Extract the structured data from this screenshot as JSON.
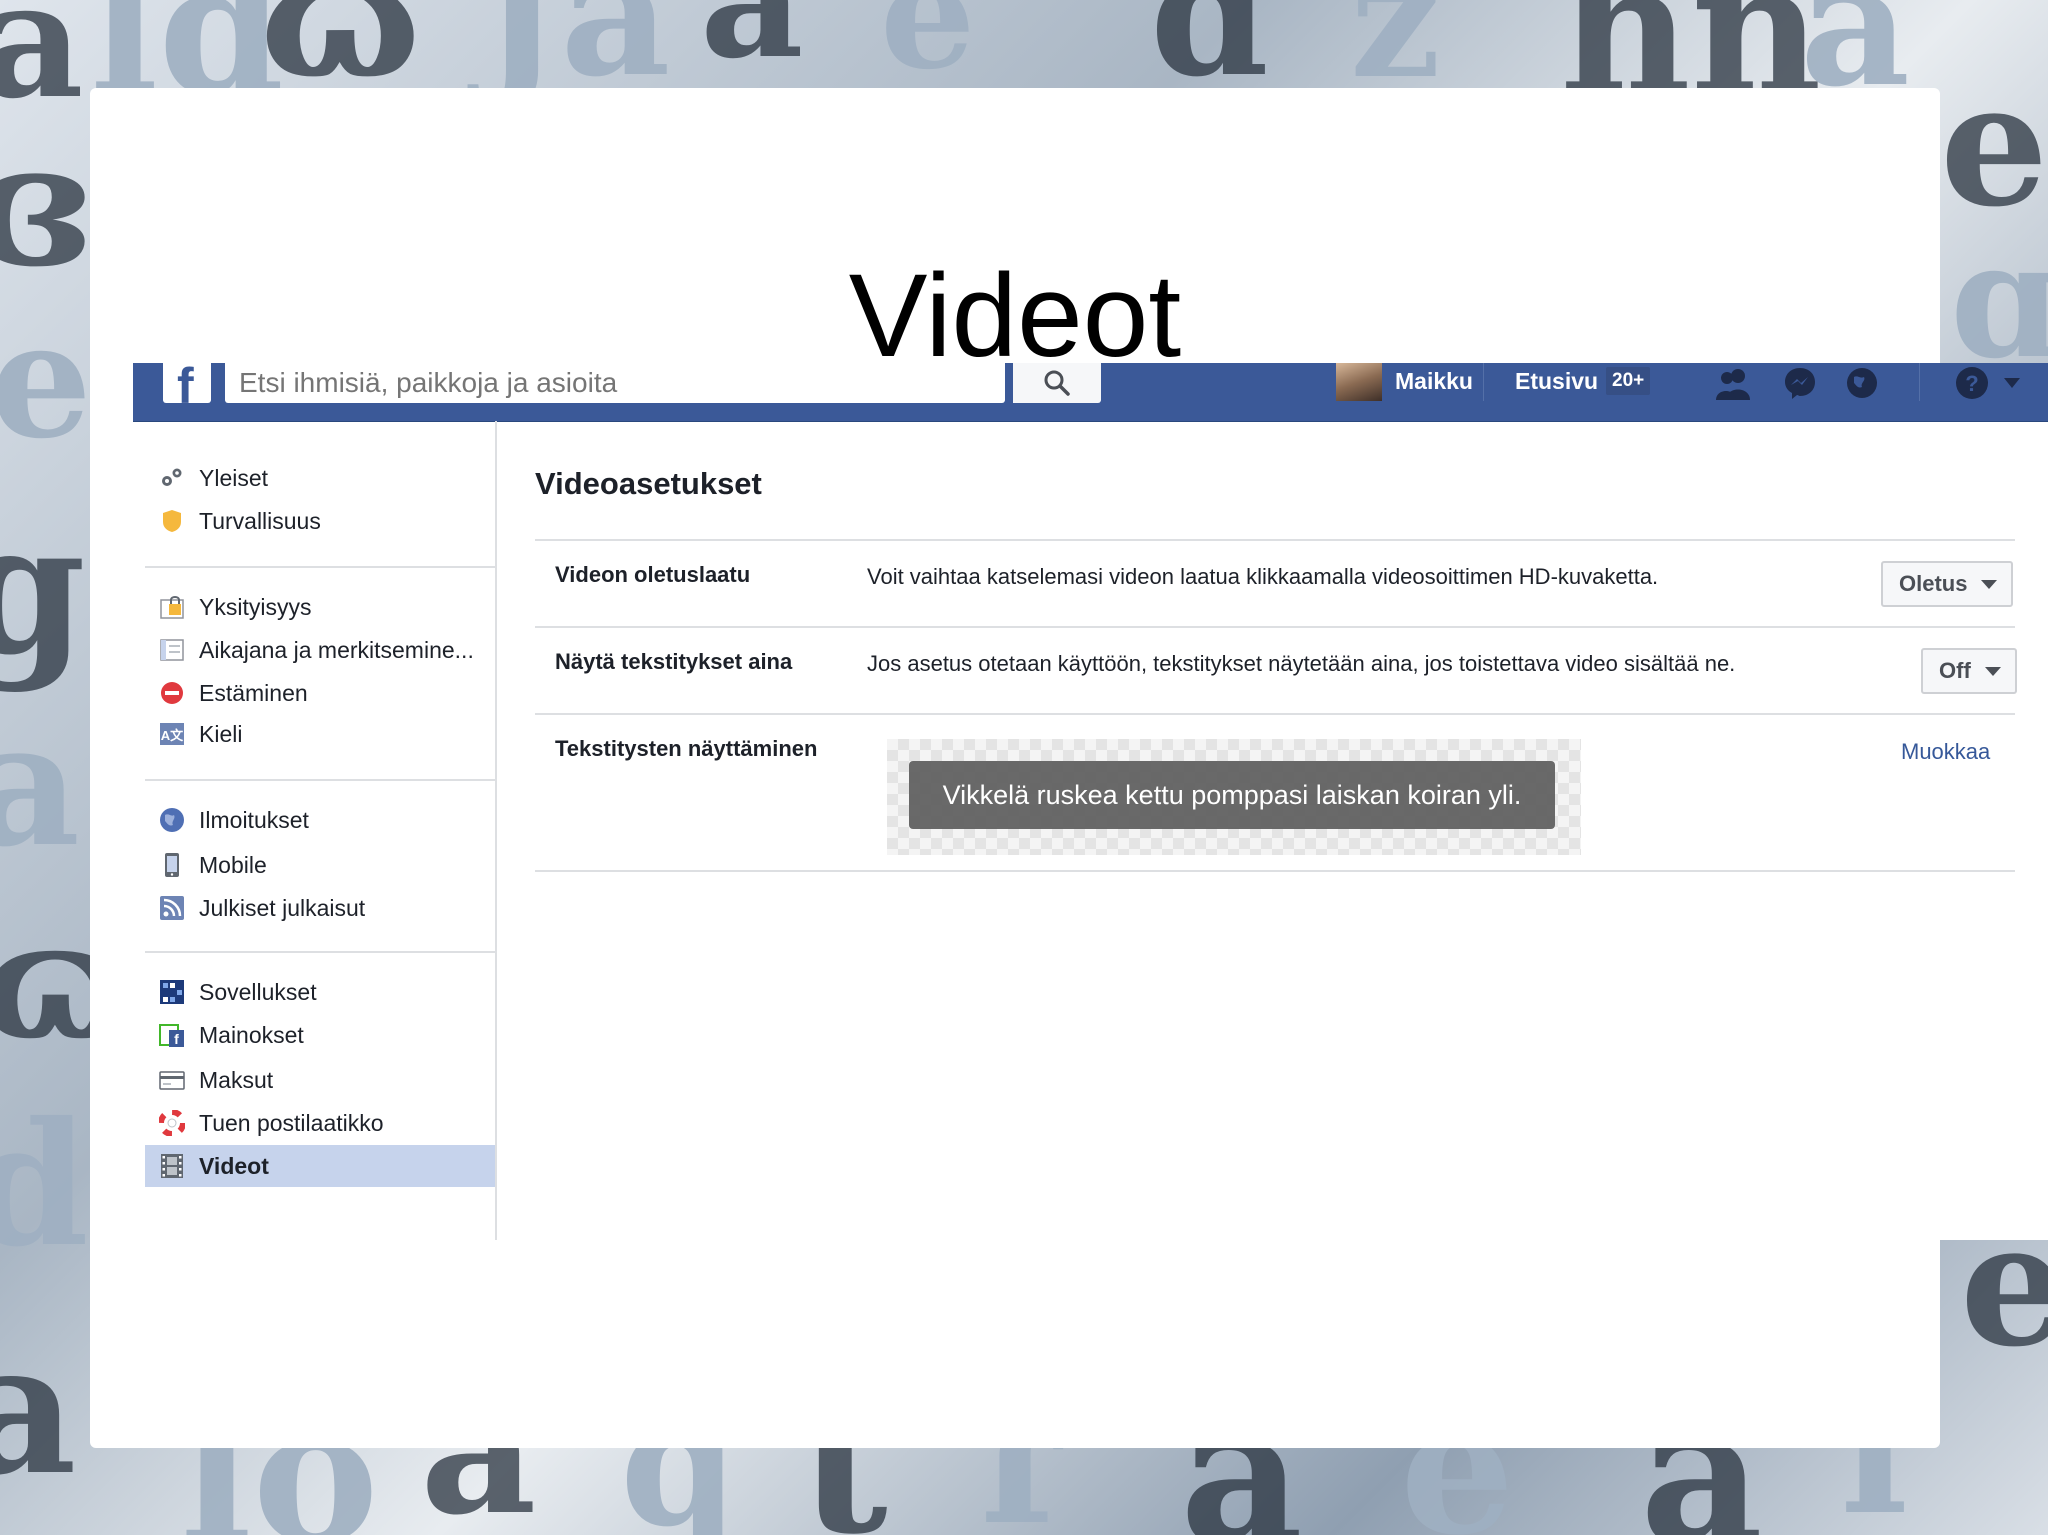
{
  "slide": {
    "title": "Videot"
  },
  "topbar": {
    "logo": "f",
    "search_placeholder": "Etsi ihmisiä, paikkoja ja asioita",
    "user_name": "Maikku",
    "home_label": "Etusivu",
    "home_badge": "20+"
  },
  "sidebar": {
    "groups": [
      [
        {
          "label": "Yleiset",
          "icon": "gears-icon"
        },
        {
          "label": "Turvallisuus",
          "icon": "badge-icon"
        }
      ],
      [
        {
          "label": "Yksityisyys",
          "icon": "lock-icon"
        },
        {
          "label": "Aikajana ja merkitsemine...",
          "icon": "timeline-icon"
        },
        {
          "label": "Estäminen",
          "icon": "block-icon"
        },
        {
          "label": "Kieli",
          "icon": "language-icon"
        }
      ],
      [
        {
          "label": "Ilmoitukset",
          "icon": "globe-icon"
        },
        {
          "label": "Mobile",
          "icon": "phone-icon"
        },
        {
          "label": "Julkiset julkaisut",
          "icon": "rss-icon"
        }
      ],
      [
        {
          "label": "Sovellukset",
          "icon": "apps-icon"
        },
        {
          "label": "Mainokset",
          "icon": "ads-icon"
        },
        {
          "label": "Maksut",
          "icon": "card-icon"
        },
        {
          "label": "Tuen postilaatikko",
          "icon": "lifebuoy-icon"
        },
        {
          "label": "Videot",
          "icon": "film-icon",
          "active": true
        }
      ]
    ]
  },
  "main": {
    "title": "Videoasetukset",
    "rows": [
      {
        "label": "Videon oletuslaatu",
        "desc": "Voit vaihtaa katselemasi videon laatua klikkaamalla videosoittimen HD-kuvaketta.",
        "control": "Oletus"
      },
      {
        "label": "Näytä tekstitykset aina",
        "desc": "Jos asetus otetaan käyttöön, tekstitykset näytetään aina, jos toistettava video sisältää ne.",
        "control": "Off"
      },
      {
        "label": "Tekstitysten näyttäminen",
        "preview_text": "Vikkelä ruskea kettu pomppasi laiskan koiran yli.",
        "action": "Muokkaa"
      }
    ]
  },
  "colors": {
    "fb_blue": "#3b5998",
    "active_bg": "#c6d3ec",
    "link": "#365899"
  }
}
